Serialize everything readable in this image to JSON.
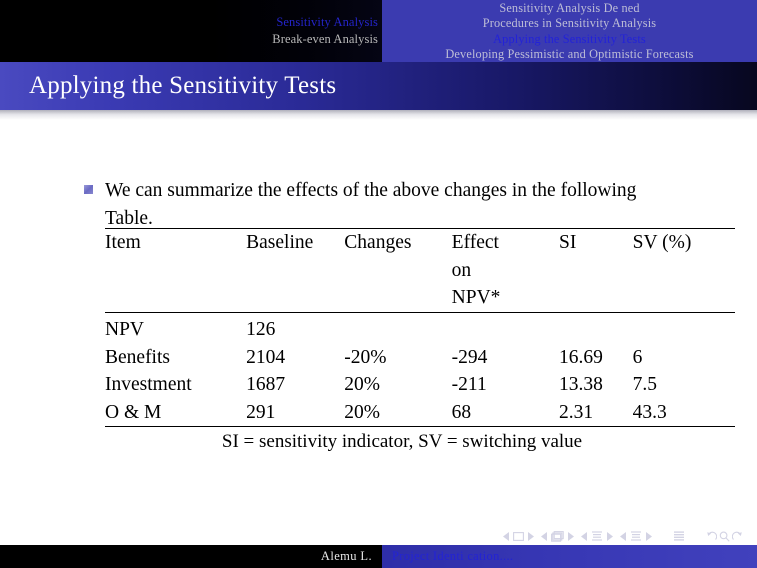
{
  "navbar": {
    "left_section": [
      {
        "label": "Sensitivity Analysis",
        "state": "current"
      },
      {
        "label": "Break-even Analysis",
        "state": "other"
      }
    ],
    "right_section": [
      {
        "label": "Sensitivity Analysis De ned",
        "state": "other"
      },
      {
        "label": "Procedures in Sensitivity Analysis",
        "state": "other"
      },
      {
        "label": "Applying the Sensitivity Tests",
        "state": "current"
      },
      {
        "label": "Developing  Pessimistic  and  Optimistic  Forecasts",
        "state": "other"
      }
    ]
  },
  "title": "Applying the Sensitivity Tests",
  "body": {
    "bullet": "We can summarize the effects of the above changes in the following Table."
  },
  "table": {
    "headers": [
      "Item",
      "Baseline",
      "Changes",
      "Effect on NPV*",
      "SI",
      "SV (%)"
    ],
    "header_effect_lines": [
      "Effect",
      "on",
      "NPV*"
    ],
    "rows": [
      {
        "item": "NPV",
        "baseline": "126",
        "changes": "",
        "effect": "",
        "si": "",
        "sv": ""
      },
      {
        "item": "Benefits",
        "baseline": "2104",
        "changes": "-20%",
        "effect": "-294",
        "si": "16.69",
        "sv": "6"
      },
      {
        "item": "Investment",
        "baseline": "1687",
        "changes": "20%",
        "effect": "-211",
        "si": "13.38",
        "sv": "7.5"
      },
      {
        "item": "O & M",
        "baseline": "291",
        "changes": "20%",
        "effect": "68",
        "si": "2.31",
        "sv": "43.3"
      }
    ],
    "note": "SI = sensitivity indicator, SV = switching value"
  },
  "nav_symbols": [
    "prev-slide-icon",
    "slide-icon",
    "next-slide-icon",
    "prev-frame-icon",
    "frame-icon",
    "next-frame-icon",
    "prev-subsection-icon",
    "subsection-icon",
    "next-subsection-icon",
    "prev-section-icon",
    "section-icon",
    "next-section-icon",
    "document-icon",
    "back-icon",
    "search-icon",
    "forward-icon"
  ],
  "footer": {
    "author": "Alemu L.",
    "document": "Project Identi cation...."
  },
  "colors": {
    "nav_blue": "#3b3bb0",
    "nav_black": "#000000",
    "title_blue": "#2a2a96",
    "highlight_blue": "#2222d8",
    "dim_text": "#bdbdd6",
    "bullet": "#6a6ac4"
  }
}
